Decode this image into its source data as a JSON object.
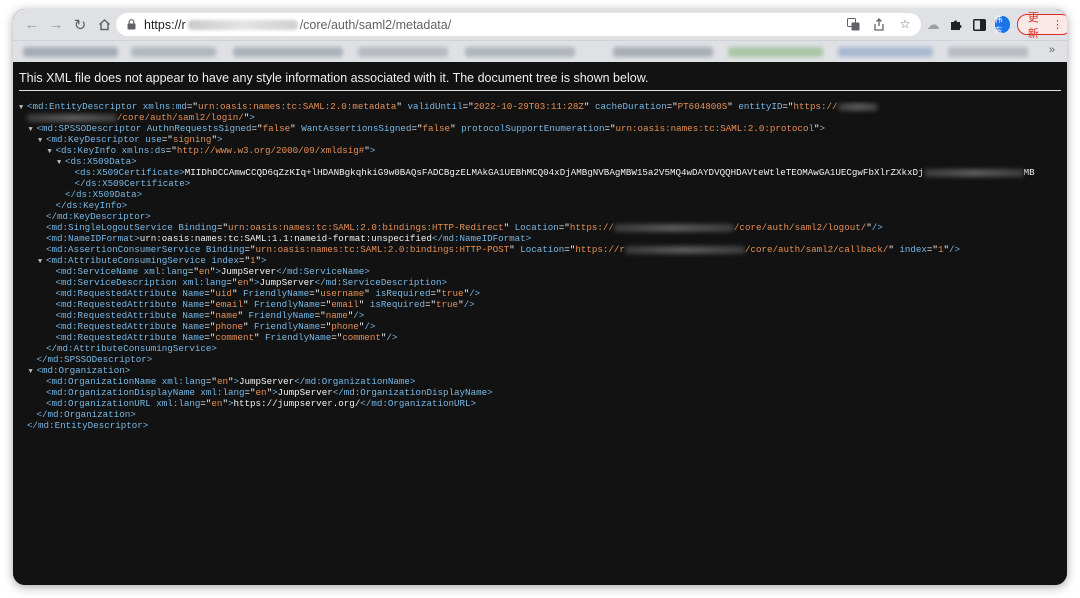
{
  "browser": {
    "url_scheme": "https://",
    "url_host_initial": "r",
    "url_path": "/core/auth/saml2/metadata/",
    "update_label": "更新",
    "avatar_label": "伟东"
  },
  "banner": "This XML file does not appear to have any style information associated with it. The document tree is shown below.",
  "xml_lines": [
    {
      "i": 0,
      "t": 1,
      "p": [
        [
          "tg",
          "<md:EntityDescriptor "
        ],
        [
          "an",
          "xmlns:md"
        ],
        [
          "tx",
          "=\""
        ],
        [
          "av",
          "urn:oasis:names:tc:SAML:2.0:metadata"
        ],
        [
          "tx",
          "\" "
        ],
        [
          "an",
          "validUntil"
        ],
        [
          "tx",
          "=\""
        ],
        [
          "av",
          "2022-10-29T03:11:28Z"
        ],
        [
          "tx",
          "\" "
        ],
        [
          "an",
          "cacheDuration"
        ],
        [
          "tx",
          "=\""
        ],
        [
          "av",
          "PT604800S"
        ],
        [
          "tx",
          "\" "
        ],
        [
          "an",
          "entityID"
        ],
        [
          "tx",
          "=\""
        ],
        [
          "av",
          "https://"
        ],
        [
          "blur",
          "40"
        ]
      ]
    },
    {
      "i": 0,
      "t": 0,
      "p": [
        [
          "blur",
          "90"
        ],
        [
          "av",
          "/core/auth/saml2/login/"
        ],
        [
          "tx",
          "\""
        ],
        [
          "tg",
          ">"
        ]
      ]
    },
    {
      "i": 1,
      "t": 1,
      "p": [
        [
          "tg",
          "<md:SPSSODescriptor "
        ],
        [
          "an",
          "AuthnRequestsSigned"
        ],
        [
          "tx",
          "=\""
        ],
        [
          "av",
          "false"
        ],
        [
          "tx",
          "\" "
        ],
        [
          "an",
          "WantAssertionsSigned"
        ],
        [
          "tx",
          "=\""
        ],
        [
          "av",
          "false"
        ],
        [
          "tx",
          "\" "
        ],
        [
          "an",
          "protocolSupportEnumeration"
        ],
        [
          "tx",
          "=\""
        ],
        [
          "av",
          "urn:oasis:names:tc:SAML:2.0:protocol"
        ],
        [
          "tx",
          "\""
        ],
        [
          "tg",
          ">"
        ]
      ]
    },
    {
      "i": 2,
      "t": 1,
      "p": [
        [
          "tg",
          "<md:KeyDescriptor "
        ],
        [
          "an",
          "use"
        ],
        [
          "tx",
          "=\""
        ],
        [
          "av",
          "signing"
        ],
        [
          "tx",
          "\""
        ],
        [
          "tg",
          ">"
        ]
      ]
    },
    {
      "i": 3,
      "t": 1,
      "p": [
        [
          "tg",
          "<ds:KeyInfo "
        ],
        [
          "an",
          "xmlns:ds"
        ],
        [
          "tx",
          "=\""
        ],
        [
          "av",
          "http://www.w3.org/2000/09/xmldsig#"
        ],
        [
          "tx",
          "\""
        ],
        [
          "tg",
          ">"
        ]
      ]
    },
    {
      "i": 4,
      "t": 1,
      "p": [
        [
          "tg",
          "<ds:X509Data>"
        ]
      ]
    },
    {
      "i": 5,
      "t": 0,
      "p": [
        [
          "tg",
          "<ds:X509Certificate>"
        ],
        [
          "tx",
          "MIIDhDCCAmwCCQD6qZzKIq+lHDANBgkqhkiG9w0BAQsFADCBgzELMAkGA1UEBhMCQ04xDjAMBgNVBAgMBW15a2V5MQ4wDAYDVQQHDAVteWtleTEOMAwGA1UECgwFbXlrZXkxDj"
        ],
        [
          "blur",
          "100"
        ],
        [
          "tx",
          "MB"
        ]
      ]
    },
    {
      "i": 5,
      "t": 0,
      "p": [
        [
          "tg",
          "</ds:X509Certificate>"
        ]
      ]
    },
    {
      "i": 4,
      "t": 0,
      "p": [
        [
          "tg",
          "</ds:X509Data>"
        ]
      ]
    },
    {
      "i": 3,
      "t": 0,
      "p": [
        [
          "tg",
          "</ds:KeyInfo>"
        ]
      ]
    },
    {
      "i": 2,
      "t": 0,
      "p": [
        [
          "tg",
          "</md:KeyDescriptor>"
        ]
      ]
    },
    {
      "i": 2,
      "t": 0,
      "p": [
        [
          "tg",
          "<md:SingleLogoutService "
        ],
        [
          "an",
          "Binding"
        ],
        [
          "tx",
          "=\""
        ],
        [
          "av",
          "urn:oasis:names:tc:SAML:2.0:bindings:HTTP-Redirect"
        ],
        [
          "tx",
          "\" "
        ],
        [
          "an",
          "Location"
        ],
        [
          "tx",
          "=\""
        ],
        [
          "av",
          "https://"
        ],
        [
          "blur",
          "120"
        ],
        [
          "av",
          "/core/auth/saml2/logout/"
        ],
        [
          "tx",
          "\""
        ],
        [
          "tg",
          "/>"
        ]
      ]
    },
    {
      "i": 2,
      "t": 0,
      "p": [
        [
          "tg",
          "<md:NameIDFormat>"
        ],
        [
          "tx",
          "urn:oasis:names:tc:SAML:1.1:nameid-format:unspecified"
        ],
        [
          "tg",
          "</md:NameIDFormat>"
        ]
      ]
    },
    {
      "i": 2,
      "t": 0,
      "p": [
        [
          "tg",
          "<md:AssertionConsumerService "
        ],
        [
          "an",
          "Binding"
        ],
        [
          "tx",
          "=\""
        ],
        [
          "av",
          "urn:oasis:names:tc:SAML:2.0:bindings:HTTP-POST"
        ],
        [
          "tx",
          "\" "
        ],
        [
          "an",
          "Location"
        ],
        [
          "tx",
          "=\""
        ],
        [
          "av",
          "https://r"
        ],
        [
          "blur",
          "120"
        ],
        [
          "av",
          "/core/auth/saml2/callback/"
        ],
        [
          "tx",
          "\" "
        ],
        [
          "an",
          "index"
        ],
        [
          "tx",
          "=\""
        ],
        [
          "av",
          "1"
        ],
        [
          "tx",
          "\""
        ],
        [
          "tg",
          "/>"
        ]
      ]
    },
    {
      "i": 2,
      "t": 1,
      "p": [
        [
          "tg",
          "<md:AttributeConsumingService "
        ],
        [
          "an",
          "index"
        ],
        [
          "tx",
          "=\""
        ],
        [
          "av",
          "1"
        ],
        [
          "tx",
          "\""
        ],
        [
          "tg",
          ">"
        ]
      ]
    },
    {
      "i": 3,
      "t": 0,
      "p": [
        [
          "tg",
          "<md:ServiceName "
        ],
        [
          "an",
          "xml:lang"
        ],
        [
          "tx",
          "=\""
        ],
        [
          "av",
          "en"
        ],
        [
          "tx",
          "\""
        ],
        [
          "tg",
          ">"
        ],
        [
          "tx",
          "JumpServer"
        ],
        [
          "tg",
          "</md:ServiceName>"
        ]
      ]
    },
    {
      "i": 3,
      "t": 0,
      "p": [
        [
          "tg",
          "<md:ServiceDescription "
        ],
        [
          "an",
          "xml:lang"
        ],
        [
          "tx",
          "=\""
        ],
        [
          "av",
          "en"
        ],
        [
          "tx",
          "\""
        ],
        [
          "tg",
          ">"
        ],
        [
          "tx",
          "JumpServer"
        ],
        [
          "tg",
          "</md:ServiceDescription>"
        ]
      ]
    },
    {
      "i": 3,
      "t": 0,
      "p": [
        [
          "tg",
          "<md:RequestedAttribute "
        ],
        [
          "an",
          "Name"
        ],
        [
          "tx",
          "=\""
        ],
        [
          "av",
          "uid"
        ],
        [
          "tx",
          "\" "
        ],
        [
          "an",
          "FriendlyName"
        ],
        [
          "tx",
          "=\""
        ],
        [
          "av",
          "username"
        ],
        [
          "tx",
          "\" "
        ],
        [
          "an",
          "isRequired"
        ],
        [
          "tx",
          "=\""
        ],
        [
          "av",
          "true"
        ],
        [
          "tx",
          "\""
        ],
        [
          "tg",
          "/>"
        ]
      ]
    },
    {
      "i": 3,
      "t": 0,
      "p": [
        [
          "tg",
          "<md:RequestedAttribute "
        ],
        [
          "an",
          "Name"
        ],
        [
          "tx",
          "=\""
        ],
        [
          "av",
          "email"
        ],
        [
          "tx",
          "\" "
        ],
        [
          "an",
          "FriendlyName"
        ],
        [
          "tx",
          "=\""
        ],
        [
          "av",
          "email"
        ],
        [
          "tx",
          "\" "
        ],
        [
          "an",
          "isRequired"
        ],
        [
          "tx",
          "=\""
        ],
        [
          "av",
          "true"
        ],
        [
          "tx",
          "\""
        ],
        [
          "tg",
          "/>"
        ]
      ]
    },
    {
      "i": 3,
      "t": 0,
      "p": [
        [
          "tg",
          "<md:RequestedAttribute "
        ],
        [
          "an",
          "Name"
        ],
        [
          "tx",
          "=\""
        ],
        [
          "av",
          "name"
        ],
        [
          "tx",
          "\" "
        ],
        [
          "an",
          "FriendlyName"
        ],
        [
          "tx",
          "=\""
        ],
        [
          "av",
          "name"
        ],
        [
          "tx",
          "\""
        ],
        [
          "tg",
          "/>"
        ]
      ]
    },
    {
      "i": 3,
      "t": 0,
      "p": [
        [
          "tg",
          "<md:RequestedAttribute "
        ],
        [
          "an",
          "Name"
        ],
        [
          "tx",
          "=\""
        ],
        [
          "av",
          "phone"
        ],
        [
          "tx",
          "\" "
        ],
        [
          "an",
          "FriendlyName"
        ],
        [
          "tx",
          "=\""
        ],
        [
          "av",
          "phone"
        ],
        [
          "tx",
          "\""
        ],
        [
          "tg",
          "/>"
        ]
      ]
    },
    {
      "i": 3,
      "t": 0,
      "p": [
        [
          "tg",
          "<md:RequestedAttribute "
        ],
        [
          "an",
          "Name"
        ],
        [
          "tx",
          "=\""
        ],
        [
          "av",
          "comment"
        ],
        [
          "tx",
          "\" "
        ],
        [
          "an",
          "FriendlyName"
        ],
        [
          "tx",
          "=\""
        ],
        [
          "av",
          "comment"
        ],
        [
          "tx",
          "\""
        ],
        [
          "tg",
          "/>"
        ]
      ]
    },
    {
      "i": 2,
      "t": 0,
      "p": [
        [
          "tg",
          "</md:AttributeConsumingService>"
        ]
      ]
    },
    {
      "i": 1,
      "t": 0,
      "p": [
        [
          "tg",
          "</md:SPSSODescriptor>"
        ]
      ]
    },
    {
      "i": 1,
      "t": 1,
      "p": [
        [
          "tg",
          "<md:Organization>"
        ]
      ]
    },
    {
      "i": 2,
      "t": 0,
      "p": [
        [
          "tg",
          "<md:OrganizationName "
        ],
        [
          "an",
          "xml:lang"
        ],
        [
          "tx",
          "=\""
        ],
        [
          "av",
          "en"
        ],
        [
          "tx",
          "\""
        ],
        [
          "tg",
          ">"
        ],
        [
          "tx",
          "JumpServer"
        ],
        [
          "tg",
          "</md:OrganizationName>"
        ]
      ]
    },
    {
      "i": 2,
      "t": 0,
      "p": [
        [
          "tg",
          "<md:OrganizationDisplayName "
        ],
        [
          "an",
          "xml:lang"
        ],
        [
          "tx",
          "=\""
        ],
        [
          "av",
          "en"
        ],
        [
          "tx",
          "\""
        ],
        [
          "tg",
          ">"
        ],
        [
          "tx",
          "JumpServer"
        ],
        [
          "tg",
          "</md:OrganizationDisplayName>"
        ]
      ]
    },
    {
      "i": 2,
      "t": 0,
      "p": [
        [
          "tg",
          "<md:OrganizationURL "
        ],
        [
          "an",
          "xml:lang"
        ],
        [
          "tx",
          "=\""
        ],
        [
          "av",
          "en"
        ],
        [
          "tx",
          "\""
        ],
        [
          "tg",
          ">"
        ],
        [
          "tx",
          "https://jumpserver.org/"
        ],
        [
          "tg",
          "</md:OrganizationURL>"
        ]
      ]
    },
    {
      "i": 1,
      "t": 0,
      "p": [
        [
          "tg",
          "</md:Organization>"
        ]
      ]
    },
    {
      "i": 0,
      "t": 0,
      "p": [
        [
          "tg",
          "</md:EntityDescriptor>"
        ]
      ]
    }
  ]
}
